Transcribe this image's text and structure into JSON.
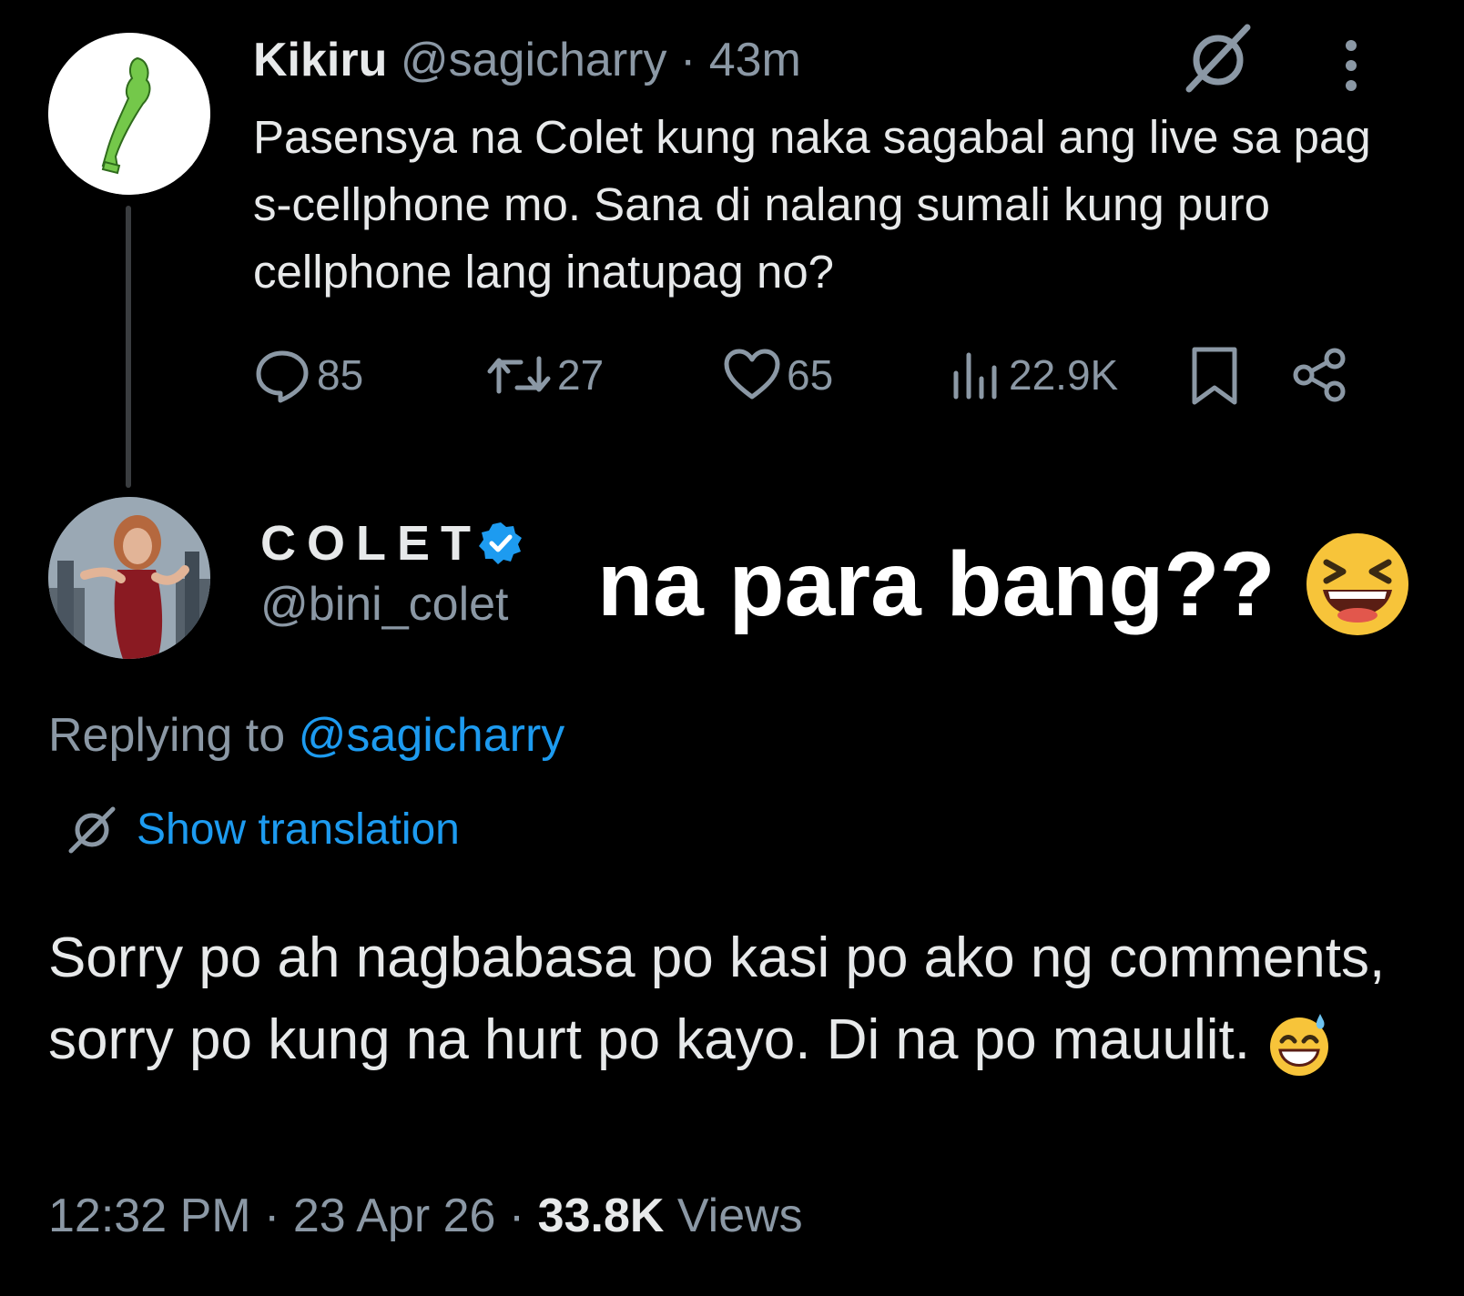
{
  "tweet1": {
    "name": "Kikiru",
    "handle": "@sagicharry",
    "time": "43m",
    "text": "Pasensya na Colet kung naka sagabal ang live sa pag s-cellphone mo. Sana di nalang sumali kung puro cellphone lang inatupag no?",
    "replies": "85",
    "retweets": "27",
    "likes": "65",
    "views": "22.9K"
  },
  "tweet2": {
    "name": "COLET",
    "handle": "@bini_colet",
    "replying_label": "Replying to",
    "replying_handle": "@sagicharry",
    "show_translation": "Show translation",
    "text": "Sorry po ah nagbabasa po kasi po ako ng comments, sorry po kung na hurt po kayo. Di na po mauulit.",
    "time": "12:32 PM",
    "date": "23 Apr 26",
    "views_count": "33.8K",
    "views_label": "Views"
  },
  "overlay_caption": "na para bang??",
  "colors": {
    "background": "#000000",
    "link": "#1d9bf0",
    "muted": "#8b98a5",
    "verified": "#1d9bf0"
  },
  "icons": [
    "grok-icon",
    "more-icon",
    "reply-icon",
    "retweet-icon",
    "like-icon",
    "views-icon",
    "bookmark-icon",
    "share-icon",
    "verified-badge-icon",
    "translate-icon",
    "laughing-emoji",
    "sweat-smile-emoji"
  ]
}
